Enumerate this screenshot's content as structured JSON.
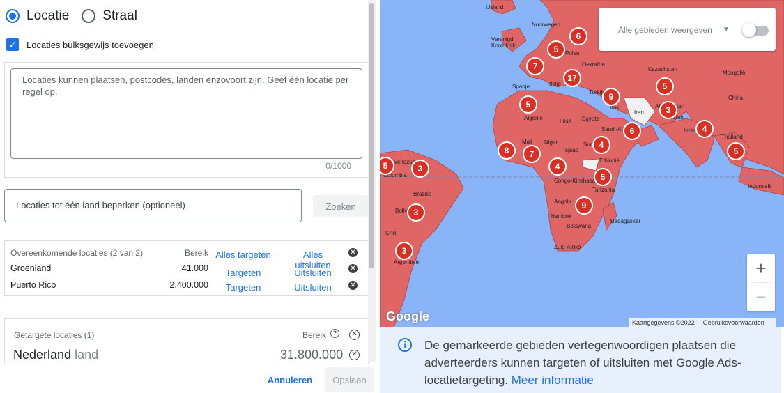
{
  "radio": {
    "location_label": "Locatie",
    "radius_label": "Straal"
  },
  "bulk": {
    "label": "Locaties bulksgewijs toevoegen"
  },
  "textarea": {
    "placeholder": "Locaties kunnen plaatsen, postcodes, landen enzovoort zijn. Geef één locatie per regel op.",
    "counter": "0/1000"
  },
  "limit": {
    "placeholder": "Locaties tot één land beperken (optioneel)",
    "search_label": "Zoeken"
  },
  "matches": {
    "header": "Overeenkomende locaties (2 van 2)",
    "reach_header": "Bereik",
    "target_all": "Alles targeten",
    "exclude_all": "Alles uitsluiten",
    "rows": [
      {
        "name": "Groenland",
        "reach": "41.000",
        "target": "Targeten",
        "exclude": "Uitsluiten"
      },
      {
        "name": "Puerto Rico",
        "reach": "2.400.000",
        "target": "Targeten",
        "exclude": "Uitsluiten"
      }
    ]
  },
  "targeted": {
    "header": "Getargete locaties (1)",
    "reach_header": "Bereik",
    "name": "Nederland",
    "kind": "land",
    "reach": "31.800.000"
  },
  "footer": {
    "cancel_label": "Annuleren",
    "save_label": "Opslaan"
  },
  "map": {
    "toggle_label": "Alle gebieden weergeven",
    "zoom_in": "+",
    "zoom_out": "−",
    "logo": "Google",
    "attribution": "Kaartgegevens ©2022",
    "terms": "Gebruiksvoorwaarden",
    "labels": [
      "IJsland",
      "Noorwegen",
      "Verenigd Koninkrijk",
      "Polen",
      "Oekraïne",
      "Kazachstan",
      "Mongolië",
      "Spanje",
      "Italië",
      "Turkije",
      "China",
      "Irak",
      "Iran",
      "Afghanistan",
      "Pakistan",
      "Algerije",
      "Libië",
      "Egypte",
      "Saudi-Arabië",
      "India",
      "Thailand",
      "Mali",
      "Niger",
      "Tsjaad",
      "Sudan",
      "Ethiopië",
      "Venezuela",
      "Colombia",
      "Congo-Kinshasa",
      "Tanzania",
      "Brazilië",
      "Bolivia",
      "Angola",
      "Namibië",
      "Botswana",
      "Madagaskar",
      "Chili",
      "Argentinië",
      "Zuid-Afrika",
      "Indonesië"
    ],
    "markers": [
      "6",
      "5",
      "7",
      "17",
      "5",
      "9",
      "3",
      "5",
      "6",
      "4",
      "5",
      "8",
      "7",
      "4",
      "4",
      "5",
      "5",
      "3",
      "9",
      "3",
      "3"
    ]
  },
  "info": {
    "text": "De gemarkeerde gebieden vertegenwoordigen plaatsen die adverteerders kunnen targeten of uitsluiten met Google Ads-locatietargeting.",
    "link": "Meer informatie"
  }
}
